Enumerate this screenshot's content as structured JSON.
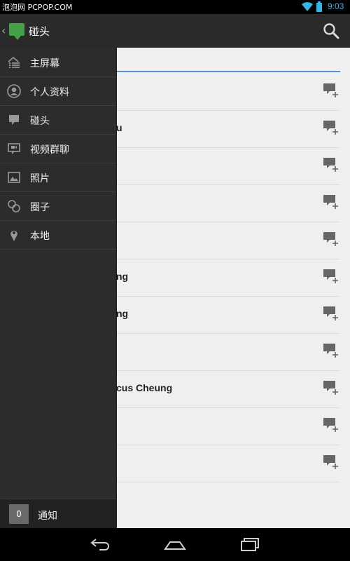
{
  "status_bar": {
    "watermark": "泡泡网 PCPOP.COM",
    "time": "9:03"
  },
  "action_bar": {
    "title": "碰头",
    "up_icon": "chevron-left-icon",
    "app_icon": "hangout-bubble-icon",
    "search_icon": "search-icon"
  },
  "drawer": {
    "items": [
      {
        "label": "主屏幕",
        "icon": "home-list-icon"
      },
      {
        "label": "个人资料",
        "icon": "profile-icon"
      },
      {
        "label": "碰头",
        "icon": "chat-bubble-icon"
      },
      {
        "label": "视频群聊",
        "icon": "video-chat-icon"
      },
      {
        "label": "照片",
        "icon": "photo-icon"
      },
      {
        "label": "圈子",
        "icon": "circles-icon"
      },
      {
        "label": "本地",
        "icon": "location-pin-icon"
      }
    ],
    "notifications": {
      "count": "0",
      "label": "通知"
    }
  },
  "content": {
    "rows": [
      {
        "name": ""
      },
      {
        "name": "u"
      },
      {
        "name": ""
      },
      {
        "name": ""
      },
      {
        "name": ""
      },
      {
        "name": "ng"
      },
      {
        "name": "ng"
      },
      {
        "name": ""
      },
      {
        "name": "cus Cheung"
      },
      {
        "name": ""
      },
      {
        "name": ""
      }
    ]
  },
  "colors": {
    "accent": "#33b5e5",
    "app_green": "#43a047",
    "separator_blue": "#5b8fd9"
  }
}
